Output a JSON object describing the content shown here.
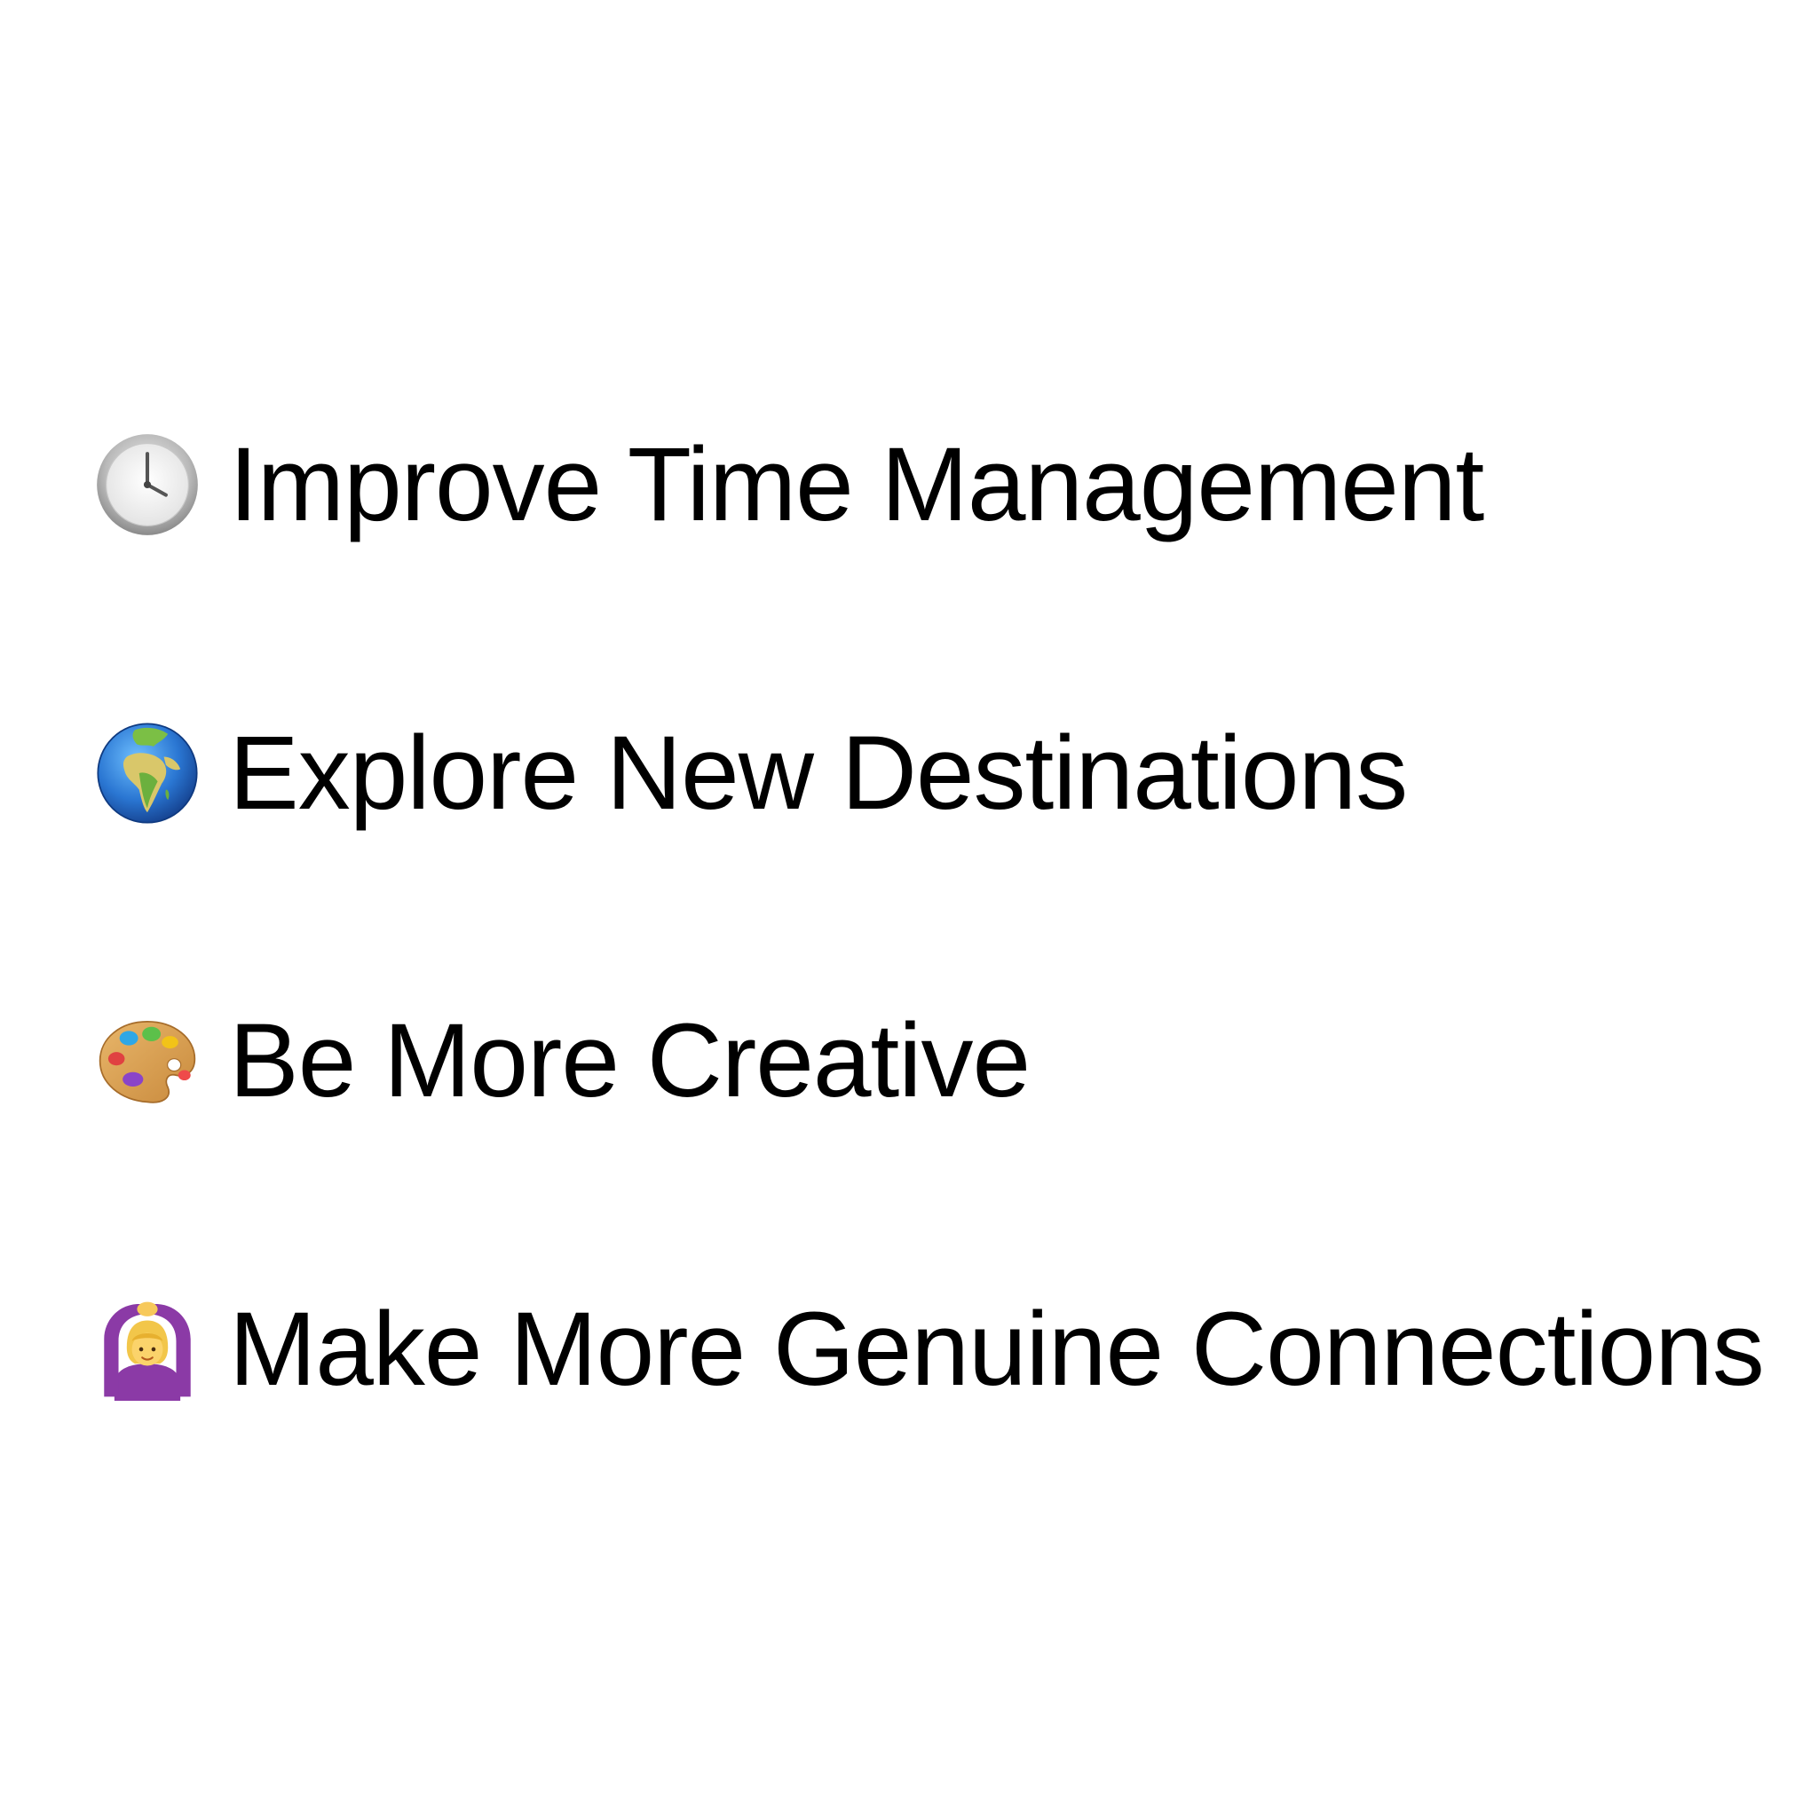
{
  "goals": [
    {
      "icon": "clock-icon",
      "text": "Improve Time Management"
    },
    {
      "icon": "globe-icon",
      "text": "Explore New Destinations"
    },
    {
      "icon": "artist-palette-icon",
      "text": "Be More Creative"
    },
    {
      "icon": "person-gesturing-ok-icon",
      "text": "Make More Genuine Connections"
    }
  ],
  "colors": {
    "background": "#ffffff",
    "text": "#000000"
  }
}
